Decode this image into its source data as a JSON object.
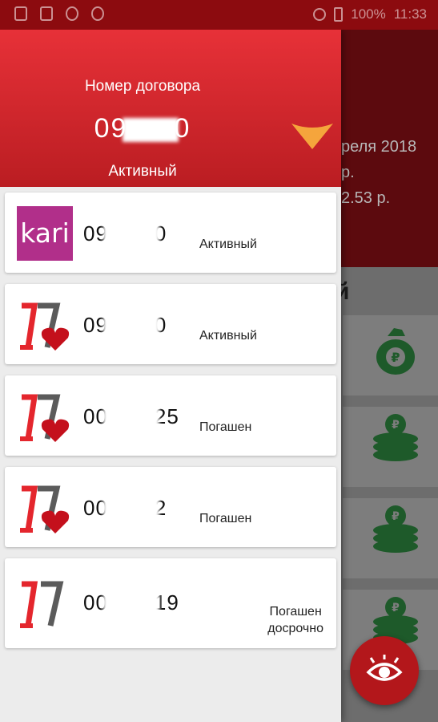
{
  "status_bar": {
    "battery": "100%",
    "time": "11:33"
  },
  "main_bg": {
    "lines": [
      "реля 2018",
      "р.",
      "2.53 р."
    ],
    "section_title": "й"
  },
  "drawer": {
    "header": {
      "label": "Номер договора",
      "number_start": "09",
      "number_end": "0",
      "status": "Активный"
    },
    "contracts": [
      {
        "logo": "kari-logo",
        "number_start": "09",
        "number_end": "0",
        "status": "Активный"
      },
      {
        "logo": "heart-logo",
        "number_start": "09",
        "number_end": "0",
        "status": "Активный"
      },
      {
        "logo": "heart-logo",
        "number_start": "00",
        "number_end": "25",
        "status": "Погашен"
      },
      {
        "logo": "heart-logo",
        "number_start": "00",
        "number_end": "2",
        "status": "Погашен"
      },
      {
        "logo": "plain-logo",
        "number_start": "00",
        "number_end": "19",
        "status_line1": "Погашен",
        "status_line2": "досрочно"
      }
    ]
  },
  "colors": {
    "brand_red": "#e4262d",
    "header_dark": "#8c0b0f",
    "accent_orange": "#f5a53c",
    "kari_purple": "#b12f8a",
    "coin_green": "#1e5a2a"
  }
}
